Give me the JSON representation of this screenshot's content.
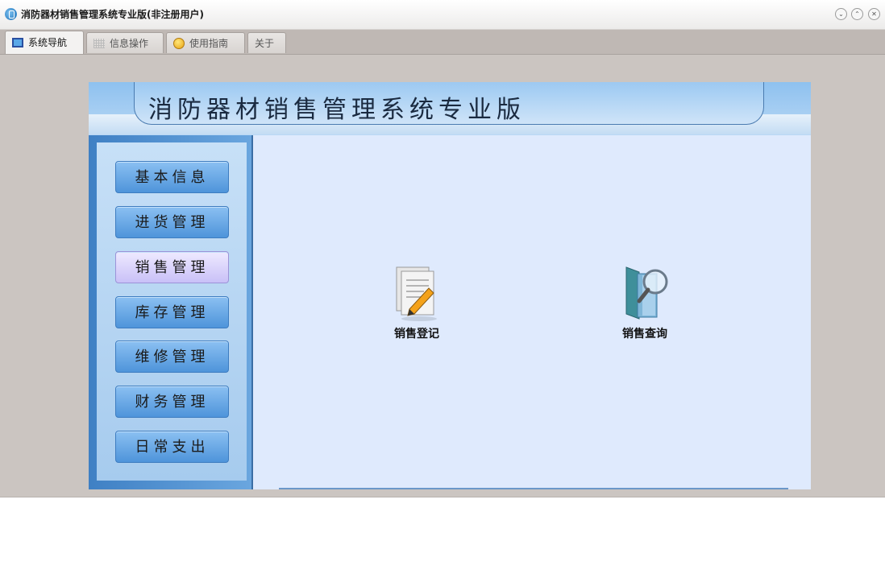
{
  "window": {
    "title": "消防器材销售管理系统专业版(非注册用户)",
    "controls": [
      "minimize-icon",
      "restore-icon",
      "close-icon"
    ]
  },
  "tabs": [
    {
      "label": "系统导航",
      "icon": "nav-icon",
      "active": true
    },
    {
      "label": "信息操作",
      "icon": "grid-icon",
      "active": false
    },
    {
      "label": "使用指南",
      "icon": "help-icon",
      "active": false
    },
    {
      "label": "关于",
      "icon": "",
      "active": false
    }
  ],
  "banner": {
    "title": "消防器材销售管理系统专业版"
  },
  "nav": {
    "items": [
      {
        "label": "基本信息"
      },
      {
        "label": "进货管理"
      },
      {
        "label": "销售管理",
        "selected": true
      },
      {
        "label": "库存管理"
      },
      {
        "label": "维修管理"
      },
      {
        "label": "财务管理"
      },
      {
        "label": "日常支出"
      }
    ]
  },
  "features": [
    {
      "label": "销售登记",
      "icon": "document-edit-icon"
    },
    {
      "label": "销售查询",
      "icon": "search-folder-icon"
    }
  ],
  "colors": {
    "accent": "#4e94da",
    "selected": "#c9c0f7",
    "content_bg": "#dfeafd"
  }
}
